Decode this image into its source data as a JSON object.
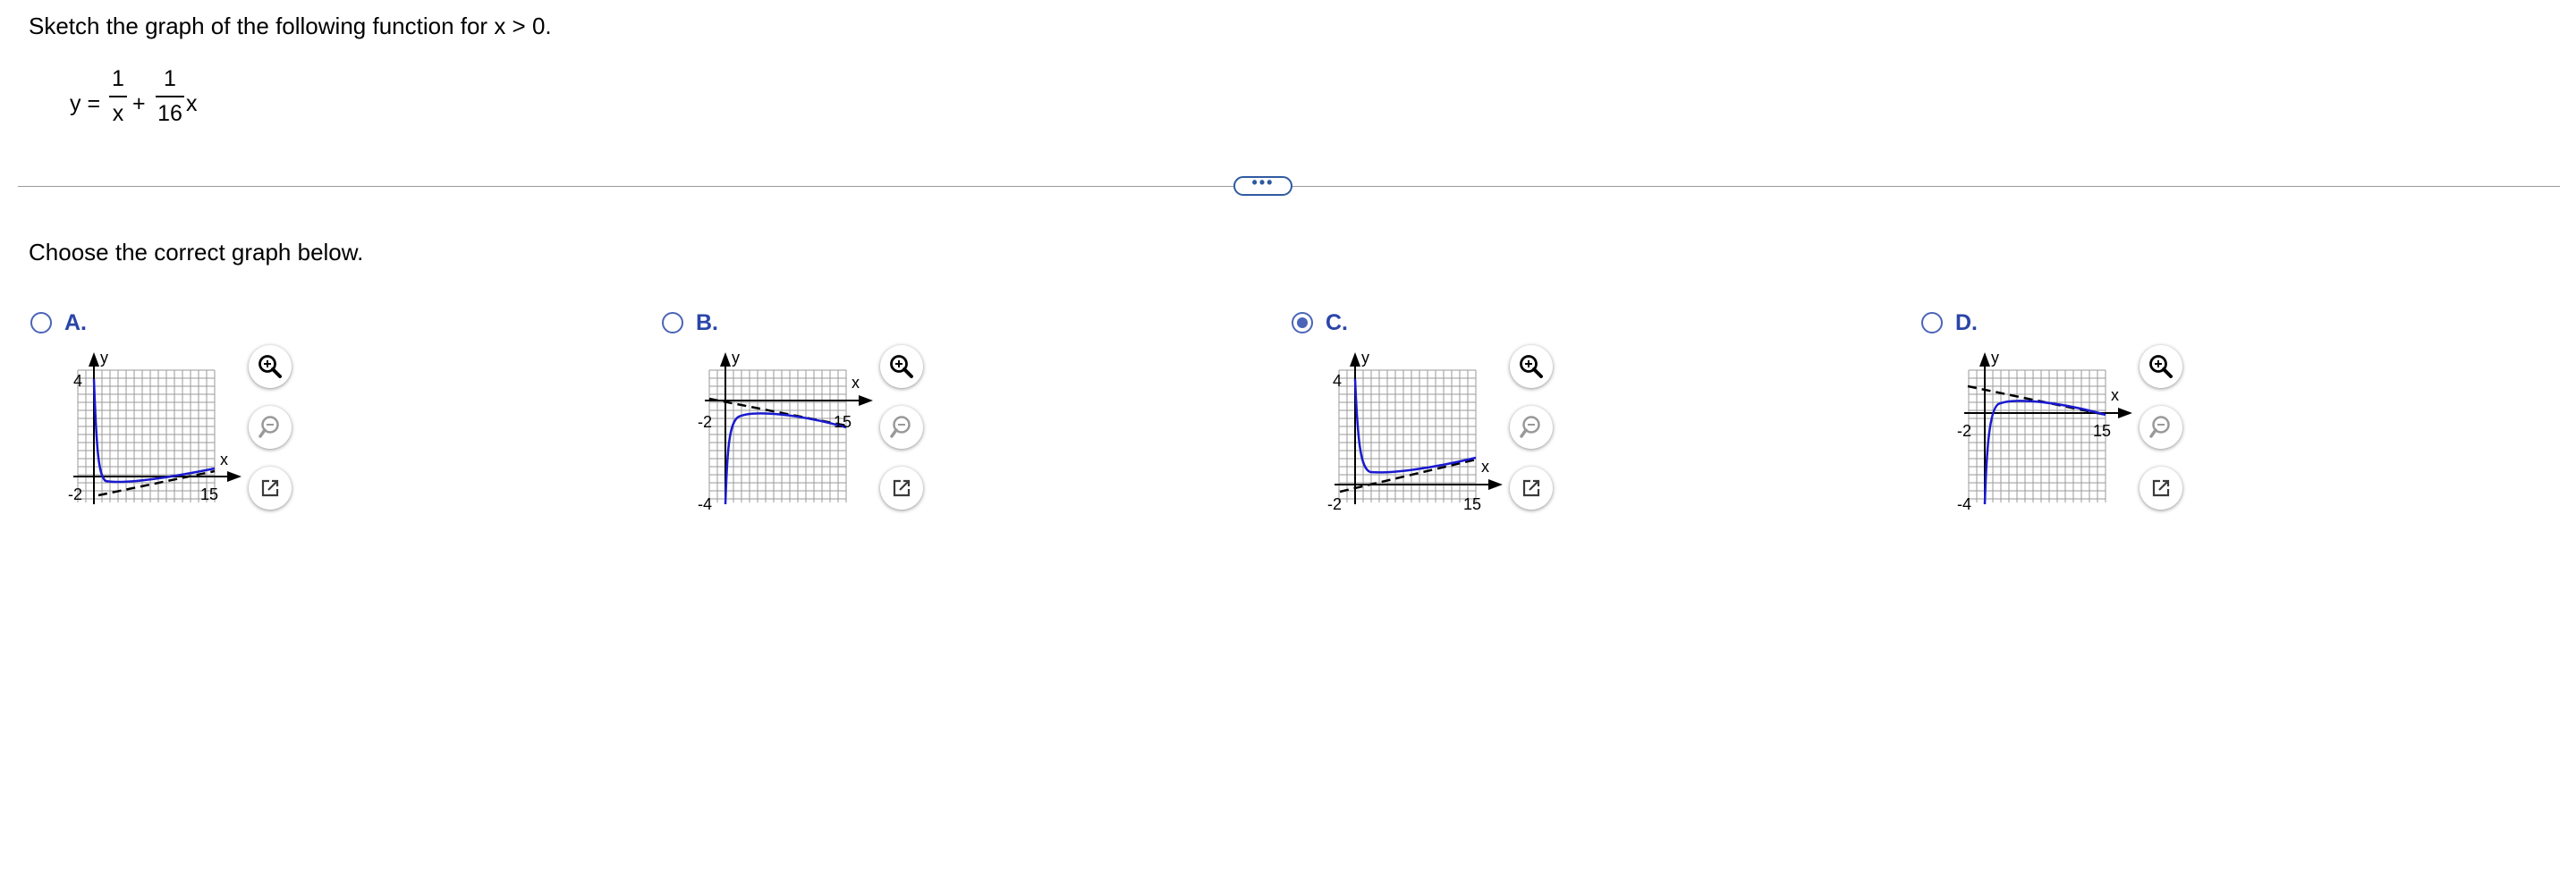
{
  "question": {
    "prompt": "Sketch the graph of the following function for x > 0.",
    "equation": {
      "lhs": "y =",
      "plus": "+",
      "frac1": {
        "num": "1",
        "den": "x"
      },
      "frac2": {
        "num": "1",
        "den": "16"
      },
      "trail": "x"
    }
  },
  "more_button": {
    "label": "•••"
  },
  "instruction": "Choose the correct graph below.",
  "options": [
    {
      "letter": "A.",
      "selected": false,
      "graph": {
        "ylabel": "y",
        "xlabel": "x",
        "ymax_label": "4",
        "ymin_label": "-2",
        "xmax_label": "15"
      }
    },
    {
      "letter": "B.",
      "selected": false,
      "graph": {
        "ylabel": "y",
        "xlabel": "x",
        "ymax_label": "-2",
        "ymin_label": "-4",
        "xmax_label": "15"
      }
    },
    {
      "letter": "C.",
      "selected": true,
      "graph": {
        "ylabel": "y",
        "xlabel": "x",
        "ymax_label": "4",
        "ymin_label": "-2",
        "xmax_label": "15"
      }
    },
    {
      "letter": "D.",
      "selected": false,
      "graph": {
        "ylabel": "y",
        "xlabel": "x",
        "ymax_label": "-2",
        "ymin_label": "-4",
        "xmax_label": "15"
      }
    }
  ],
  "tools": {
    "zoom_in": "zoom-in-icon",
    "zoom_out": "zoom-out-icon",
    "popout": "popout-icon"
  },
  "colors": {
    "accent": "#2a45a8",
    "curve": "#1a1ad0",
    "grid": "#9a9a9a"
  }
}
